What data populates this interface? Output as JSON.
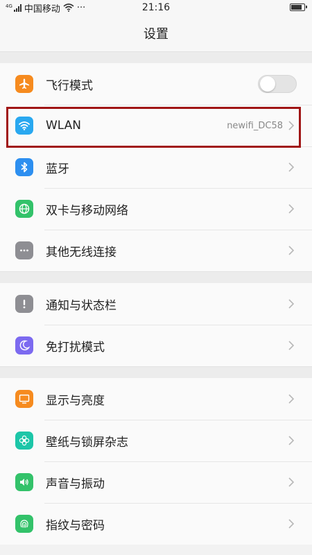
{
  "status_bar": {
    "network_label": "4G",
    "carrier": "中国移动",
    "more": "···",
    "time": "21:16"
  },
  "header": {
    "title": "设置"
  },
  "groups": [
    {
      "items": [
        {
          "label": "飞行模式",
          "icon": "airplane-icon",
          "color": "#f68b1f",
          "control": "toggle",
          "on": false
        },
        {
          "label": "WLAN",
          "icon": "wifi-icon",
          "color": "#29a8f0",
          "value": "newifi_DC58",
          "highlighted": true
        },
        {
          "label": "蓝牙",
          "icon": "bluetooth-icon",
          "color": "#2d8ff0"
        },
        {
          "label": "双卡与移动网络",
          "icon": "globe-icon",
          "color": "#33c26a"
        },
        {
          "label": "其他无线连接",
          "icon": "more-dots-icon",
          "color": "#8e8e93"
        }
      ]
    },
    {
      "items": [
        {
          "label": "通知与状态栏",
          "icon": "exclamation-icon",
          "color": "#8e8e93"
        },
        {
          "label": "免打扰模式",
          "icon": "moon-icon",
          "color": "#7c6af0"
        }
      ]
    },
    {
      "items": [
        {
          "label": "显示与亮度",
          "icon": "display-icon",
          "color": "#f68b1f"
        },
        {
          "label": "壁纸与锁屏杂志",
          "icon": "flower-icon",
          "color": "#1cc6a8"
        },
        {
          "label": "声音与振动",
          "icon": "speaker-icon",
          "color": "#33c26a"
        },
        {
          "label": "指纹与密码",
          "icon": "fingerprint-icon",
          "color": "#33c26a"
        }
      ]
    }
  ],
  "highlight_color": "#a01515"
}
